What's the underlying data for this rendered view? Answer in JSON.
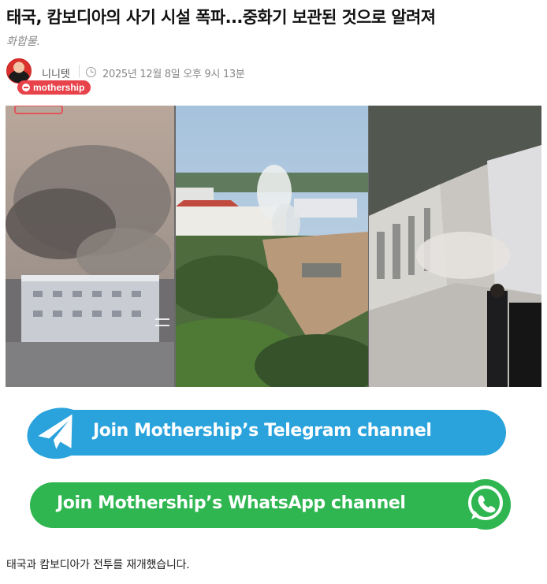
{
  "article": {
    "title": "태국, 캄보디아의 사기 시설 폭파...중화기 보관된 것으로 알려져",
    "subtitle": "화합물.",
    "author": "니니텟",
    "date": "2025년 12월 8일 오후 9시 13분",
    "source_badge": "mothership",
    "body_first_line": "태국과 캄보디아가 전투를 재개했습니다."
  },
  "cta": {
    "telegram_label": "Join Mothership’s Telegram channel",
    "whatsapp_label": "Join Mothership’s WhatsApp channel"
  },
  "icons": {
    "avatar": "author-avatar",
    "clock": "clock-icon",
    "telegram": "telegram-icon",
    "whatsapp": "whatsapp-icon"
  },
  "colors": {
    "telegram_blue": "#2aa3dc",
    "whatsapp_green": "#2fb651",
    "brand_red": "#e8424a"
  }
}
